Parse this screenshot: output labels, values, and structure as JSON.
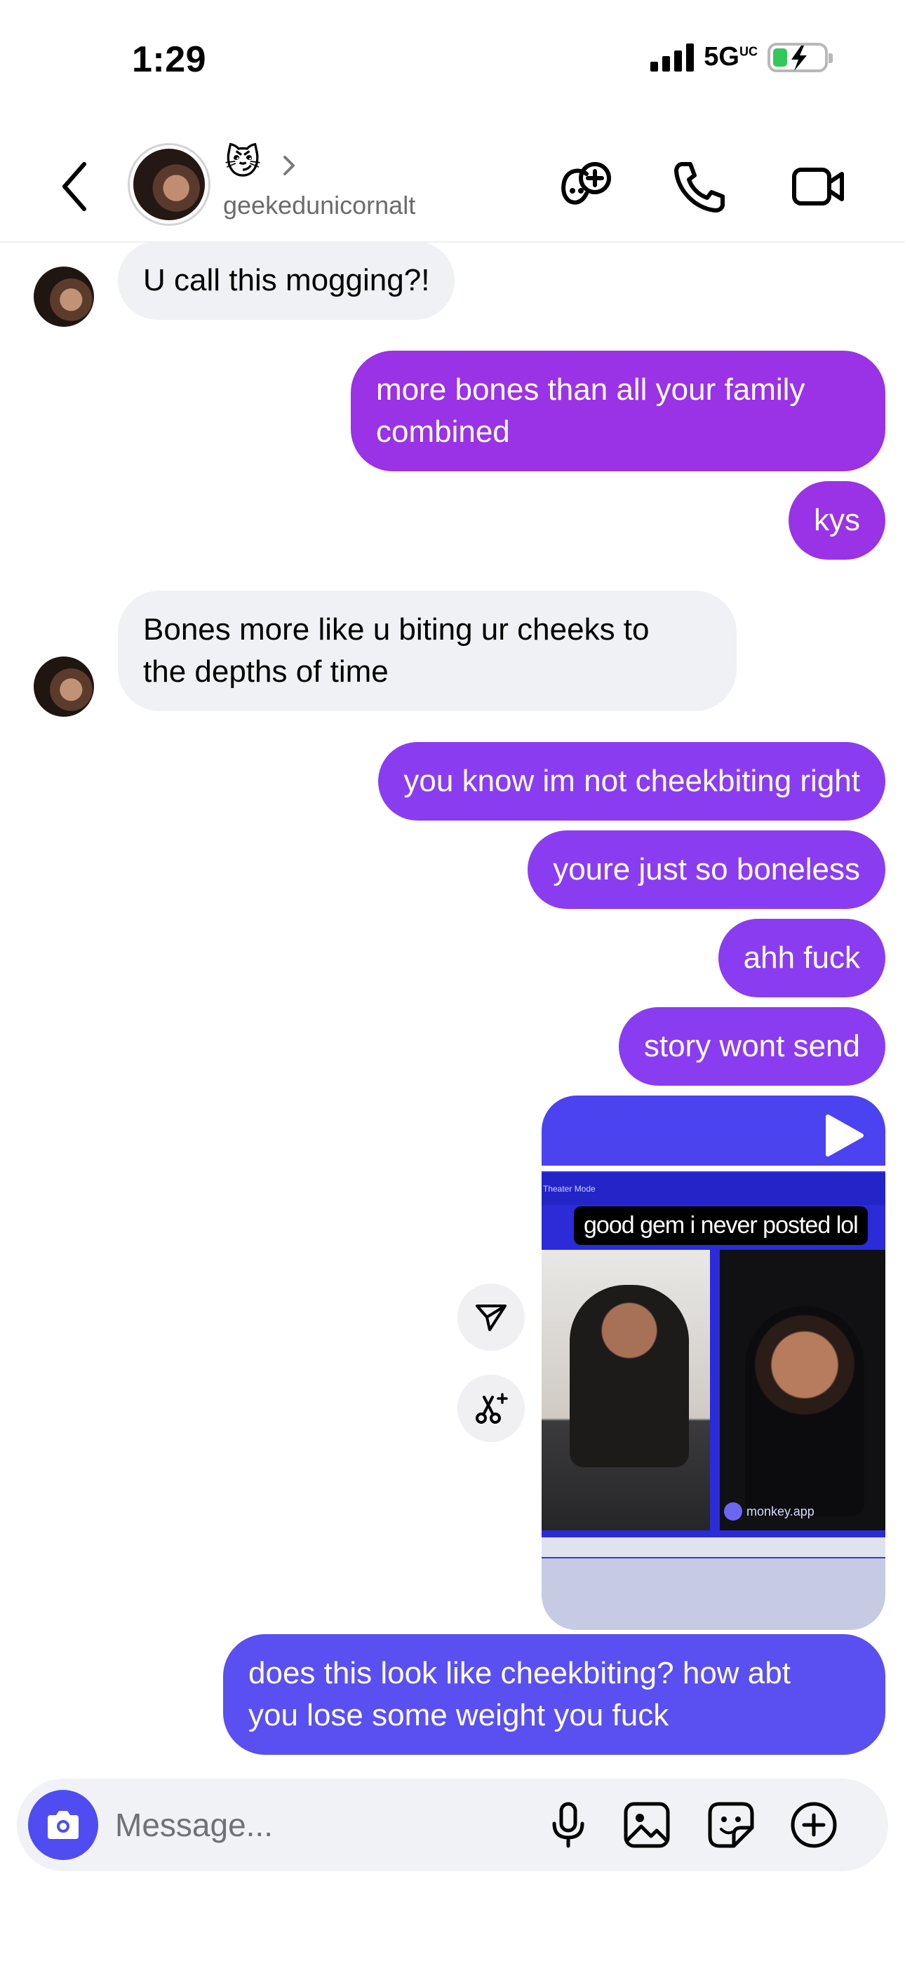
{
  "status_bar": {
    "time": "1:29",
    "network": "5G",
    "network_suffix": "UC"
  },
  "header": {
    "emoji": "😼",
    "username": "geekedunicornalt"
  },
  "messages": [
    {
      "from": "them",
      "text": "U call this mogging?!"
    },
    {
      "from": "me",
      "text_lines": [
        "more bones than all your family",
        "combined"
      ]
    },
    {
      "from": "me",
      "text": "kys"
    },
    {
      "from": "them",
      "text_lines": [
        "Bones more like u biting ur cheeks to",
        "the depths of time"
      ]
    },
    {
      "from": "me",
      "text": "you know im not cheekbiting right"
    },
    {
      "from": "me",
      "text": "youre just so boneless"
    },
    {
      "from": "me",
      "text": "ahh fuck"
    },
    {
      "from": "me",
      "text": "story wont send"
    },
    {
      "from": "me",
      "type": "reel",
      "caption": "good gem i never posted lol",
      "brand": "monkey.app",
      "top_bar_label": "Theater Mode"
    },
    {
      "from": "me",
      "text_lines": [
        "does this look like cheekbiting? how abt",
        "you lose some weight you fuck"
      ]
    }
  ],
  "composer": {
    "placeholder": "Message..."
  },
  "colors": {
    "bubble_incoming": "#eff1f4",
    "bubble_purple": "#9a32e6",
    "bubble_violet": "#8a3df0",
    "bubble_blue": "#5a4ff0",
    "camera_button": "#4f4cf2"
  },
  "icons": [
    "back-chevron-icon",
    "chevron-right-icon",
    "games-icon",
    "phone-icon",
    "video-call-icon",
    "send-icon",
    "remix-icon",
    "play-icon",
    "camera-icon",
    "microphone-icon",
    "gallery-icon",
    "sticker-icon",
    "plus-circle-icon"
  ]
}
